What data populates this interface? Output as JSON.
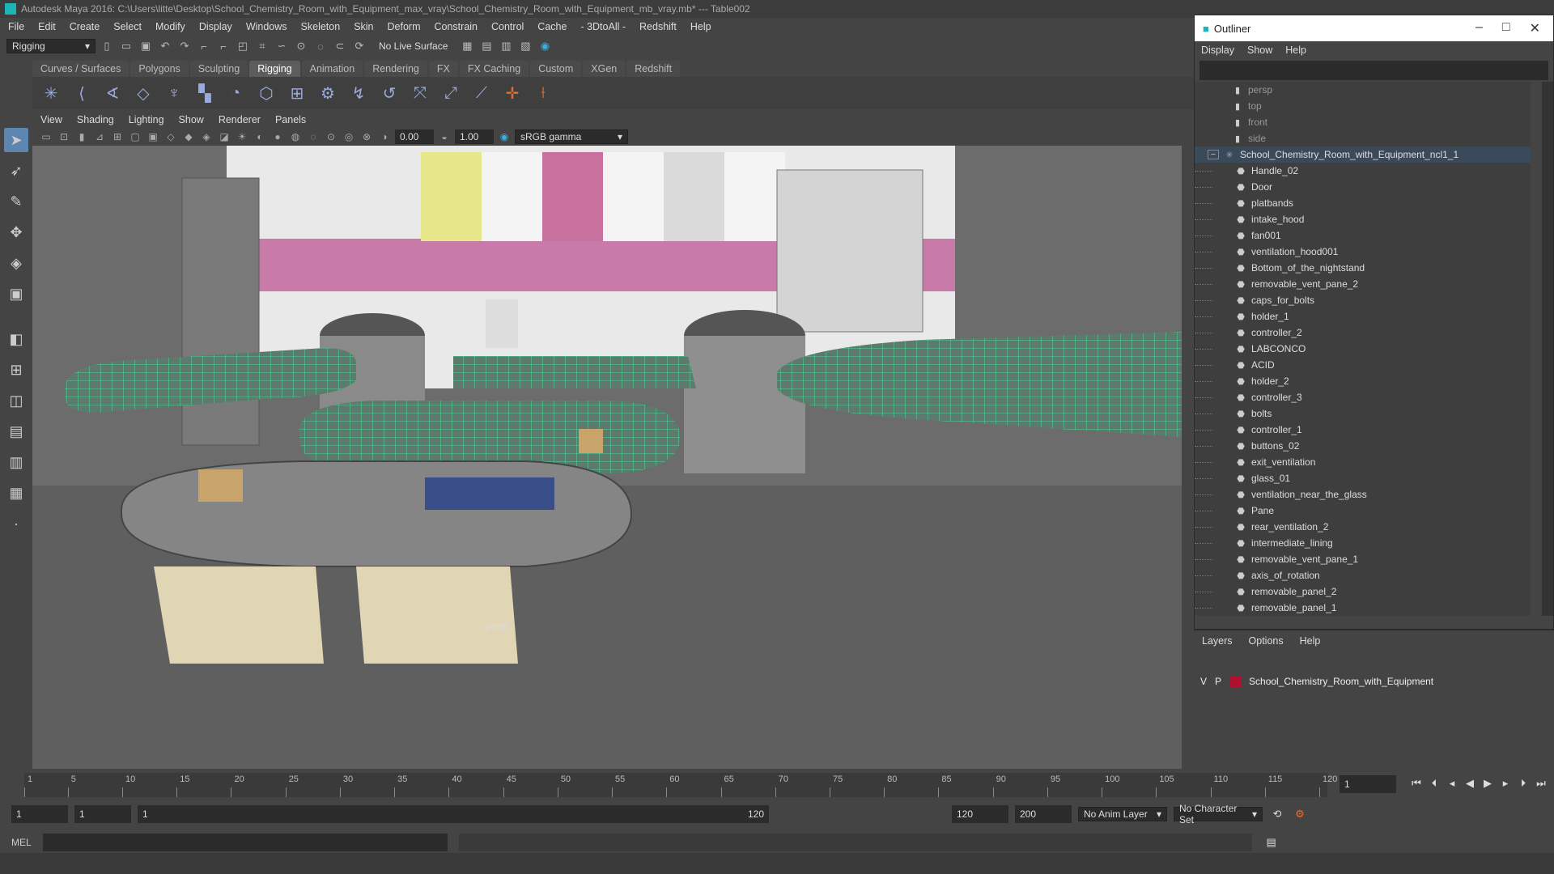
{
  "title": {
    "text": "Autodesk Maya 2016: C:\\Users\\litte\\Desktop\\School_Chemistry_Room_with_Equipment_max_vray\\School_Chemistry_Room_with_Equipment_mb_vray.mb*   ---   Table002"
  },
  "menus": [
    "File",
    "Edit",
    "Create",
    "Select",
    "Modify",
    "Display",
    "Windows",
    "Skeleton",
    "Skin",
    "Deform",
    "Constrain",
    "Control",
    "Cache",
    "- 3DtoAll -",
    "Redshift",
    "Help"
  ],
  "status": {
    "mode": "Rigging",
    "live_surface": "No Live Surface"
  },
  "shelf_tabs": [
    "Curves / Surfaces",
    "Polygons",
    "Sculpting",
    "Rigging",
    "Animation",
    "Rendering",
    "FX",
    "FX Caching",
    "Custom",
    "XGen",
    "Redshift"
  ],
  "active_shelf_tab": "Rigging",
  "panel_menu": [
    "View",
    "Shading",
    "Lighting",
    "Show",
    "Renderer",
    "Panels"
  ],
  "panel_tools": {
    "exposure": "0.00",
    "gamma": "1.00",
    "colorspace": "sRGB gamma"
  },
  "viewport": {
    "camera_label": "persp"
  },
  "outliner": {
    "title": "Outliner",
    "menu": [
      "Display",
      "Show",
      "Help"
    ],
    "cameras": [
      "persp",
      "top",
      "front",
      "side"
    ],
    "root": "School_Chemistry_Room_with_Equipment_ncl1_1",
    "children": [
      "Handle_02",
      "Door",
      "platbands",
      "intake_hood",
      "fan001",
      "ventilation_hood001",
      "Bottom_of_the_nightstand",
      "removable_vent_pane_2",
      "caps_for_bolts",
      "holder_1",
      "controller_2",
      "LABCONCO",
      "ACID",
      "holder_2",
      "controller_3",
      "bolts",
      "controller_1",
      "buttons_02",
      "exit_ventilation",
      "glass_01",
      "ventilation_near_the_glass",
      "Pane",
      "rear_ventilation_2",
      "intermediate_lining",
      "removable_vent_pane_1",
      "axis_of_rotation",
      "removable_panel_2",
      "removable_panel_1"
    ]
  },
  "layers": {
    "menu": [
      "Layers",
      "Options",
      "Help"
    ],
    "row": {
      "v": "V",
      "p": "P",
      "name": "School_Chemistry_Room_with_Equipment"
    }
  },
  "timeline": {
    "ticks": [
      "1",
      "5",
      "10",
      "15",
      "20",
      "25",
      "30",
      "35",
      "40",
      "45",
      "50",
      "55",
      "60",
      "65",
      "70",
      "75",
      "80",
      "85",
      "90",
      "95",
      "100",
      "105",
      "110",
      "115",
      "120"
    ],
    "current_frame": "1"
  },
  "range": {
    "start": "1",
    "playback_start": "1",
    "slider_start": "1",
    "slider_end": "120",
    "playback_end": "120",
    "end": "200",
    "anim_layer": "No Anim Layer",
    "character_set": "No Character Set"
  },
  "command": {
    "label": "MEL"
  }
}
